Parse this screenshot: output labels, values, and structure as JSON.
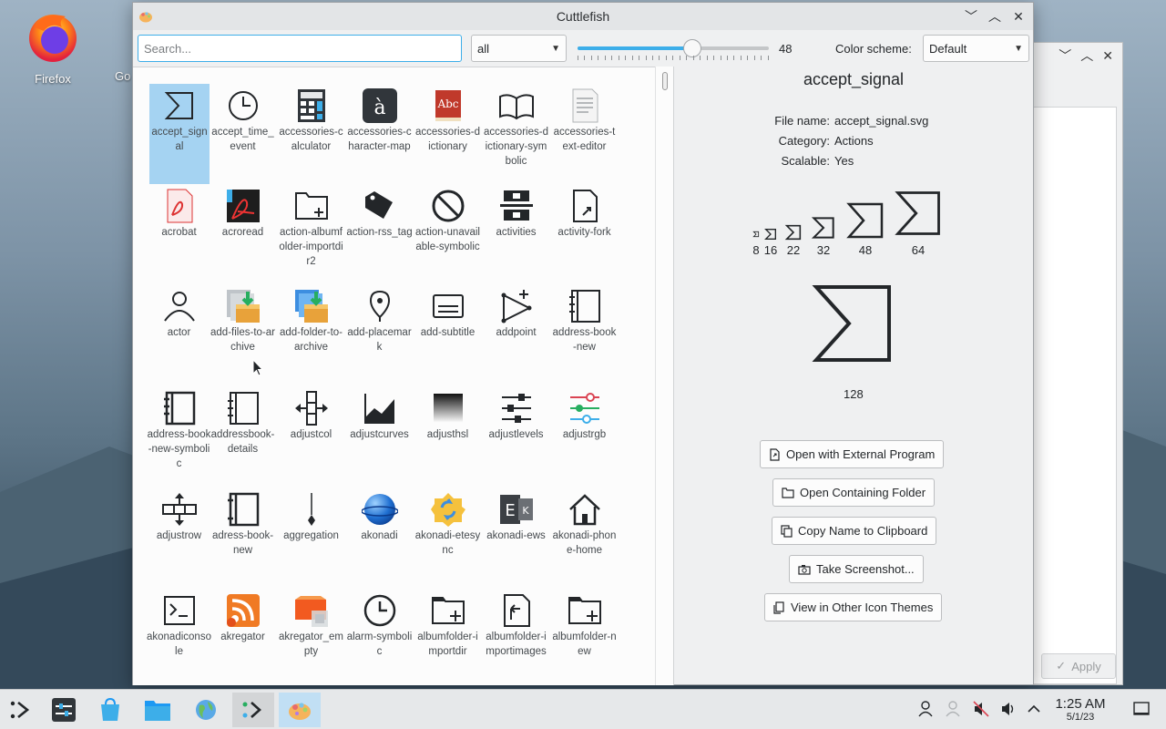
{
  "desktop": {
    "icons": [
      {
        "label": "Firefox"
      },
      {
        "label": "Go"
      }
    ]
  },
  "window": {
    "title": "Cuttlefish",
    "controls": [
      "minimize",
      "maximize",
      "close"
    ]
  },
  "toolbar": {
    "search_placeholder": "Search...",
    "search_value": "",
    "filter_value": "all",
    "size_value": "48",
    "size_fraction": 0.6,
    "color_scheme_label": "Color scheme:",
    "color_scheme_value": "Default"
  },
  "grid": {
    "selected": "accept_signal",
    "rows": [
      [
        {
          "label": "accept_signal",
          "icon": "accept-signal-icon"
        },
        {
          "label": "accept_time_event",
          "icon": "clock-icon"
        },
        {
          "label": "accessories-calculator",
          "icon": "calculator-icon"
        },
        {
          "label": "accessories-character-map",
          "icon": "character-map-icon"
        },
        {
          "label": "accessories-dictionary",
          "icon": "dictionary-icon"
        },
        {
          "label": "accessories-dictionary-symbolic",
          "icon": "book-open-icon"
        },
        {
          "label": "accessories-text-editor",
          "icon": "text-editor-icon"
        }
      ],
      [
        {
          "label": "acrobat",
          "icon": "acrobat-icon"
        },
        {
          "label": "acroread",
          "icon": "acroread-icon"
        },
        {
          "label": "action-albumfolder-importdir2",
          "icon": "folder-plus-icon"
        },
        {
          "label": "action-rss_tag",
          "icon": "tag-icon"
        },
        {
          "label": "action-unavailable-symbolic",
          "icon": "unavailable-icon"
        },
        {
          "label": "activities",
          "icon": "activities-icon"
        },
        {
          "label": "activity-fork",
          "icon": "activity-fork-icon"
        }
      ],
      [
        {
          "label": "actor",
          "icon": "actor-icon"
        },
        {
          "label": "add-files-to-archive",
          "icon": "archive-files-icon"
        },
        {
          "label": "add-folder-to-archive",
          "icon": "archive-folder-icon"
        },
        {
          "label": "add-placemark",
          "icon": "placemark-icon"
        },
        {
          "label": "add-subtitle",
          "icon": "subtitle-icon"
        },
        {
          "label": "addpoint",
          "icon": "addpoint-icon"
        },
        {
          "label": "address-book-new",
          "icon": "address-book-icon"
        }
      ],
      [
        {
          "label": "address-book-new-symbolic",
          "icon": "address-book-symbolic-icon"
        },
        {
          "label": "addressbook-details",
          "icon": "addressbook-details-icon"
        },
        {
          "label": "adjustcol",
          "icon": "adjustcol-icon"
        },
        {
          "label": "adjustcurves",
          "icon": "adjustcurves-icon"
        },
        {
          "label": "adjusthsl",
          "icon": "adjusthsl-icon"
        },
        {
          "label": "adjustlevels",
          "icon": "adjustlevels-icon"
        },
        {
          "label": "adjustrgb",
          "icon": "adjustrgb-icon"
        }
      ],
      [
        {
          "label": "adjustrow",
          "icon": "adjustrow-icon"
        },
        {
          "label": "adress-book-new",
          "icon": "adress-book-icon"
        },
        {
          "label": "aggregation",
          "icon": "aggregation-icon"
        },
        {
          "label": "akonadi",
          "icon": "akonadi-icon"
        },
        {
          "label": "akonadi-etesync",
          "icon": "etesync-icon"
        },
        {
          "label": "akonadi-ews",
          "icon": "ews-icon"
        },
        {
          "label": "akonadi-phone-home",
          "icon": "phone-home-icon"
        }
      ],
      [
        {
          "label": "akonadiconsole",
          "icon": "console-icon"
        },
        {
          "label": "akregator",
          "icon": "rss-icon"
        },
        {
          "label": "akregator_empty",
          "icon": "akregator-empty-icon"
        },
        {
          "label": "alarm-symbolic",
          "icon": "alarm-icon"
        },
        {
          "label": "albumfolder-importdir",
          "icon": "albumfolder-importdir-icon"
        },
        {
          "label": "albumfolder-importimages",
          "icon": "albumfolder-importimages-icon"
        },
        {
          "label": "albumfolder-new",
          "icon": "albumfolder-new-icon"
        }
      ]
    ]
  },
  "detail": {
    "title": "accept_signal",
    "meta": [
      {
        "key": "File name:",
        "value": "accept_signal.svg"
      },
      {
        "key": "Category:",
        "value": "Actions"
      },
      {
        "key": "Scalable:",
        "value": "Yes"
      }
    ],
    "sizes": [
      "8",
      "16",
      "22",
      "32",
      "48",
      "64"
    ],
    "big_size": "128",
    "buttons": [
      {
        "label": "Open with External Program",
        "icon": "document-open-icon"
      },
      {
        "label": "Open Containing Folder",
        "icon": "folder-icon"
      },
      {
        "label": "Copy Name to Clipboard",
        "icon": "copy-icon"
      },
      {
        "label": "Take Screenshot...",
        "icon": "camera-icon"
      },
      {
        "label": "View in Other Icon Themes",
        "icon": "view-themes-icon"
      }
    ]
  },
  "background_window": {
    "apply_label": "Apply"
  },
  "taskbar": {
    "time": "1:25 AM",
    "date": "5/1/23"
  }
}
